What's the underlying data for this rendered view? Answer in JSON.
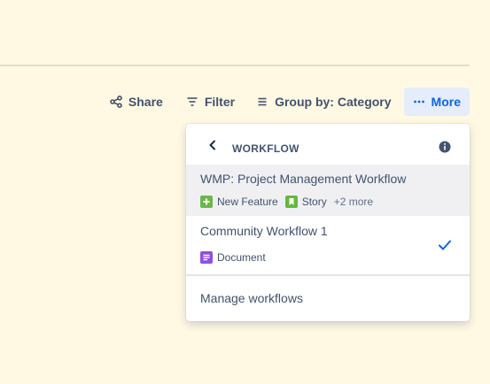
{
  "toolbar": {
    "share_label": "Share",
    "filter_label": "Filter",
    "group_label": "Group by: Category",
    "more_label": "More",
    "more_icon": "ellipsis-icon",
    "accent": "#0c66e4"
  },
  "workflow_menu": {
    "title": "WORKFLOW",
    "items": [
      {
        "name": "WMP: Project Management Workflow",
        "tags": [
          {
            "label": "New Feature",
            "icon": "new-feature-icon",
            "color": "#6a9a23"
          },
          {
            "label": "Story",
            "icon": "story-icon",
            "color": "#63ba3c"
          }
        ],
        "more": "+2 more"
      },
      {
        "name": "Community Workflow 1",
        "tags": [
          {
            "label": "Document",
            "icon": "document-icon",
            "color": "#8f50e0"
          }
        ]
      }
    ],
    "manage_label": "Manage workflows"
  }
}
